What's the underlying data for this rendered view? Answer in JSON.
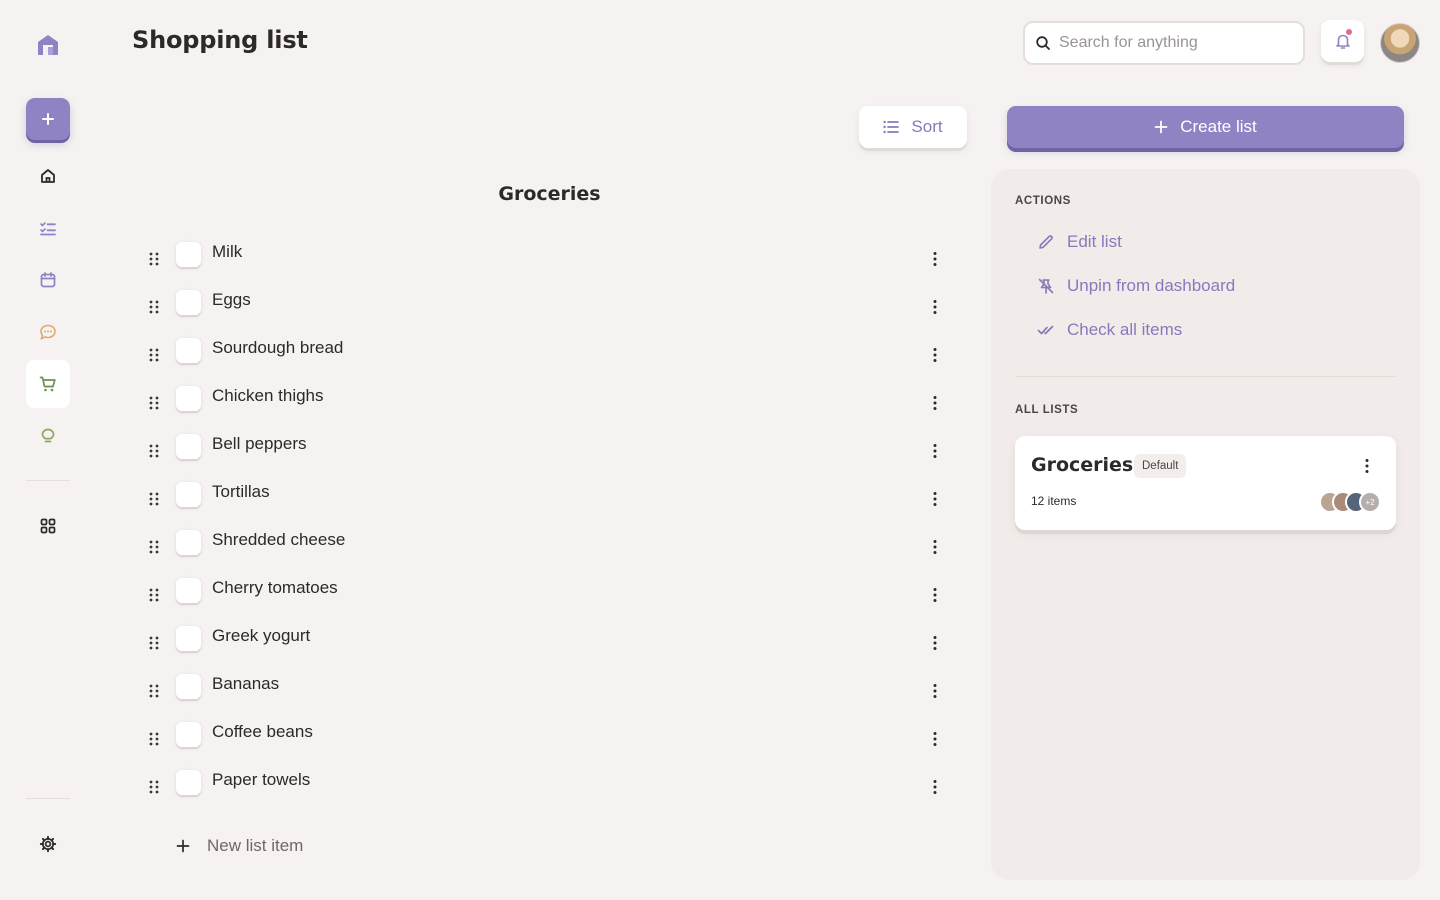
{
  "header": {
    "title": "Shopping list",
    "search_placeholder": "Search for anything"
  },
  "sidebar": {
    "items": [
      {
        "name": "home",
        "icon": "home-icon"
      },
      {
        "name": "tasks",
        "icon": "checklist-icon"
      },
      {
        "name": "calendar",
        "icon": "calendar-icon"
      },
      {
        "name": "chat",
        "icon": "chat-icon"
      },
      {
        "name": "shopping",
        "icon": "cart-icon",
        "active": true
      },
      {
        "name": "ideas",
        "icon": "lightbulb-icon"
      },
      {
        "name": "apps",
        "icon": "grid-icon"
      },
      {
        "name": "settings",
        "icon": "gear-icon"
      }
    ]
  },
  "toolbar": {
    "sort_label": "Sort",
    "create_label": "Create list"
  },
  "list": {
    "title": "Groceries",
    "items": [
      "Milk",
      "Eggs",
      "Sourdough bread",
      "Chicken thighs",
      "Bell peppers",
      "Tortillas",
      "Shredded cheese",
      "Cherry tomatoes",
      "Greek yogurt",
      "Bananas",
      "Coffee beans",
      "Paper towels"
    ],
    "new_item_label": "New list item"
  },
  "actions": {
    "heading": "ACTIONS",
    "edit": "Edit list",
    "unpin": "Unpin from dashboard",
    "check_all": "Check all items"
  },
  "all_lists": {
    "heading": "ALL LISTS",
    "cards": [
      {
        "title": "Groceries",
        "badge": "Default",
        "count": "12 items",
        "more_members": "+2"
      }
    ]
  },
  "colors": {
    "accent": "#8f83c4",
    "accent_text": "#8679bd",
    "background": "#f6f2f1",
    "notification_dot": "#e36b85"
  }
}
